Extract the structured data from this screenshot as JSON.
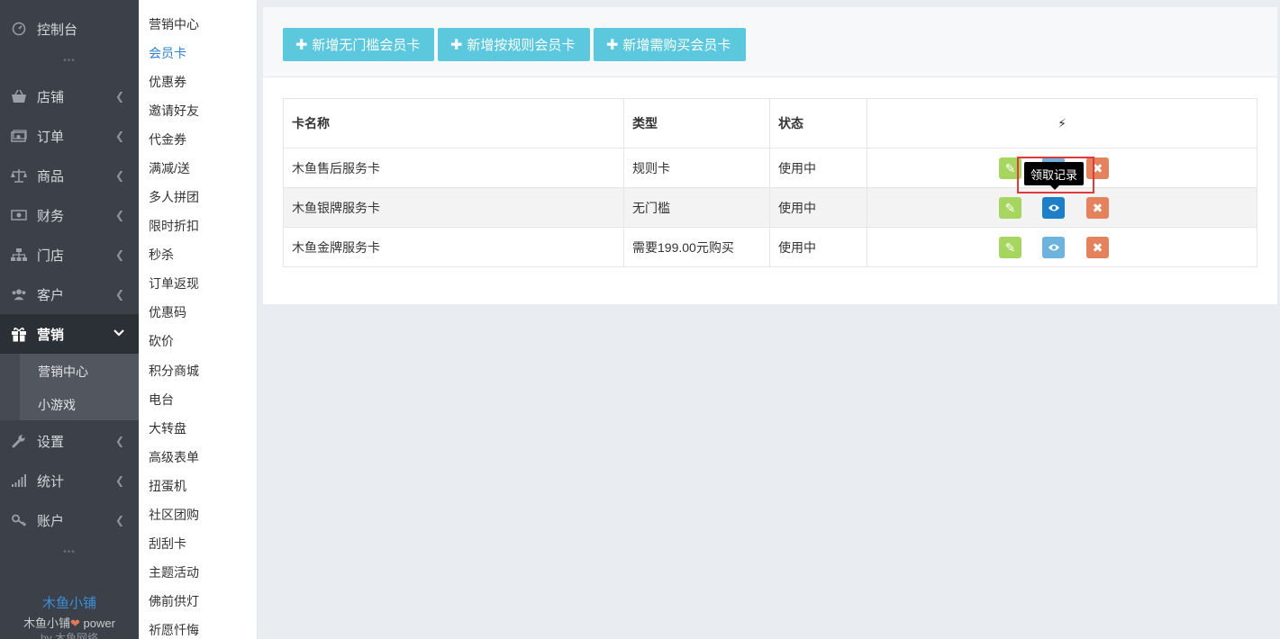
{
  "sidebar": {
    "items": [
      {
        "key": "dashboard",
        "label": "控制台",
        "icon": "dashboard-icon"
      },
      {
        "key": "shop",
        "label": "店铺",
        "icon": "basket-icon"
      },
      {
        "key": "orders",
        "label": "订单",
        "icon": "money-icon"
      },
      {
        "key": "goods",
        "label": "商品",
        "icon": "scale-icon"
      },
      {
        "key": "finance",
        "label": "财务",
        "icon": "cash-icon"
      },
      {
        "key": "stores",
        "label": "门店",
        "icon": "sitemap-icon"
      },
      {
        "key": "customers",
        "label": "客户",
        "icon": "users-icon"
      },
      {
        "key": "marketing",
        "label": "营销",
        "icon": "gift-icon"
      },
      {
        "key": "settings",
        "label": "设置",
        "icon": "wrench-icon"
      },
      {
        "key": "stats",
        "label": "统计",
        "icon": "signal-icon"
      },
      {
        "key": "account",
        "label": "账户",
        "icon": "key-icon"
      }
    ],
    "marketing_sub": [
      "营销中心",
      "小游戏"
    ],
    "footer": {
      "brand": "木鱼小铺",
      "power_prefix": "木鱼小铺",
      "power_suffix": " power",
      "by": "by 木鱼网络"
    }
  },
  "submenu": {
    "items": [
      "营销中心",
      "会员卡",
      "优惠券",
      "邀请好友",
      "代金券",
      "满减/送",
      "多人拼团",
      "限时折扣",
      "秒杀",
      "订单返现",
      "优惠码",
      "砍价",
      "积分商城",
      "电台",
      "大转盘",
      "高级表单",
      "扭蛋机",
      "社区团购",
      "刮刮卡",
      "主题活动",
      "佛前供灯",
      "祈愿忏悔"
    ],
    "current": "会员卡"
  },
  "toolbar": {
    "add_no_threshold": "新增无门槛会员卡",
    "add_by_rule": "新增按规则会员卡",
    "add_purchase": "新增需购买会员卡"
  },
  "table": {
    "headers": {
      "name": "卡名称",
      "type": "类型",
      "status": "状态",
      "actions": "⚡"
    },
    "rows": [
      {
        "name": "木鱼售后服务卡",
        "type": "规则卡",
        "status": "使用中"
      },
      {
        "name": "木鱼银牌服务卡",
        "type": "无门槛",
        "status": "使用中"
      },
      {
        "name": "木鱼金牌服务卡",
        "type": "需要199.00元购买",
        "status": "使用中"
      }
    ]
  },
  "tooltip": {
    "text": "领取记录"
  },
  "colors": {
    "sidebar_bg": "#3c4049",
    "accent": "#5bc8de",
    "edit": "#a6d65f",
    "view": "#6db3de",
    "view_hover": "#1d7fc7",
    "delete": "#e4825d",
    "highlight": "#e03a3a"
  }
}
